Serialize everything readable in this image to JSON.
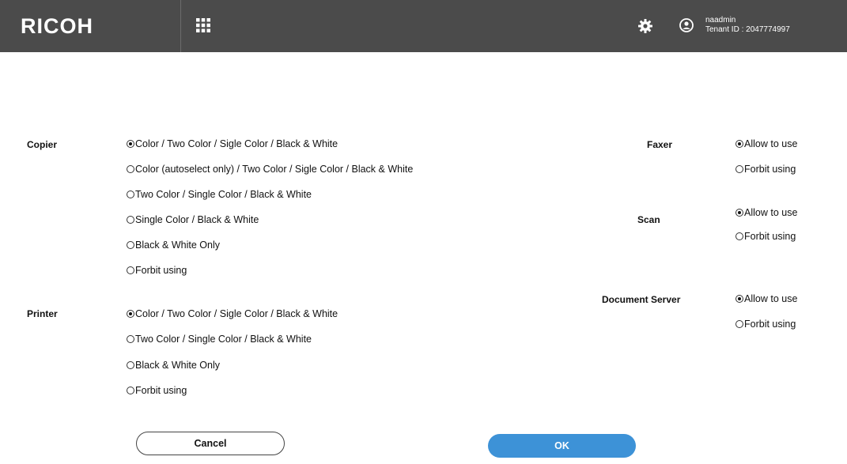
{
  "header": {
    "logo": "RICOH",
    "user_name": "naadmin",
    "tenant": "Tenant ID : 2047774997",
    "icons": [
      "apps-grid-icon",
      "gear-icon",
      "user-icon"
    ],
    "bg_color": "#4b4b4b"
  },
  "copier": {
    "label": "Copier",
    "options": [
      {
        "text": "Color / Two Color / Sigle Color / Black & White",
        "selected": true
      },
      {
        "text": "Color (autoselect only) / Two Color / Sigle Color / Black & White",
        "selected": false
      },
      {
        "text": "Two Color / Single Color / Black & White",
        "selected": false
      },
      {
        "text": "Single Color / Black & White",
        "selected": false
      },
      {
        "text": "Black & White Only",
        "selected": false
      },
      {
        "text": "Forbit using",
        "selected": false
      }
    ]
  },
  "printer": {
    "label": "Printer",
    "options": [
      {
        "text": "Color / Two Color / Sigle Color / Black & White",
        "selected": true
      },
      {
        "text": "Two Color / Single Color / Black & White",
        "selected": false
      },
      {
        "text": "Black & White Only",
        "selected": false
      },
      {
        "text": "Forbit using",
        "selected": false
      }
    ]
  },
  "faxer": {
    "label": "Faxer",
    "options": [
      {
        "text": "Allow to use",
        "selected": true
      },
      {
        "text": "Forbit using",
        "selected": false
      }
    ]
  },
  "scan": {
    "label": "Scan",
    "options": [
      {
        "text": "Allow to use",
        "selected": true
      },
      {
        "text": "Forbit using",
        "selected": false
      }
    ]
  },
  "document_server": {
    "label": "Document Server",
    "options": [
      {
        "text": "Allow to use",
        "selected": true
      },
      {
        "text": "Forbit using",
        "selected": false
      }
    ]
  },
  "buttons": {
    "cancel": "Cancel",
    "ok": "OK",
    "ok_color": "#3d92d7"
  }
}
